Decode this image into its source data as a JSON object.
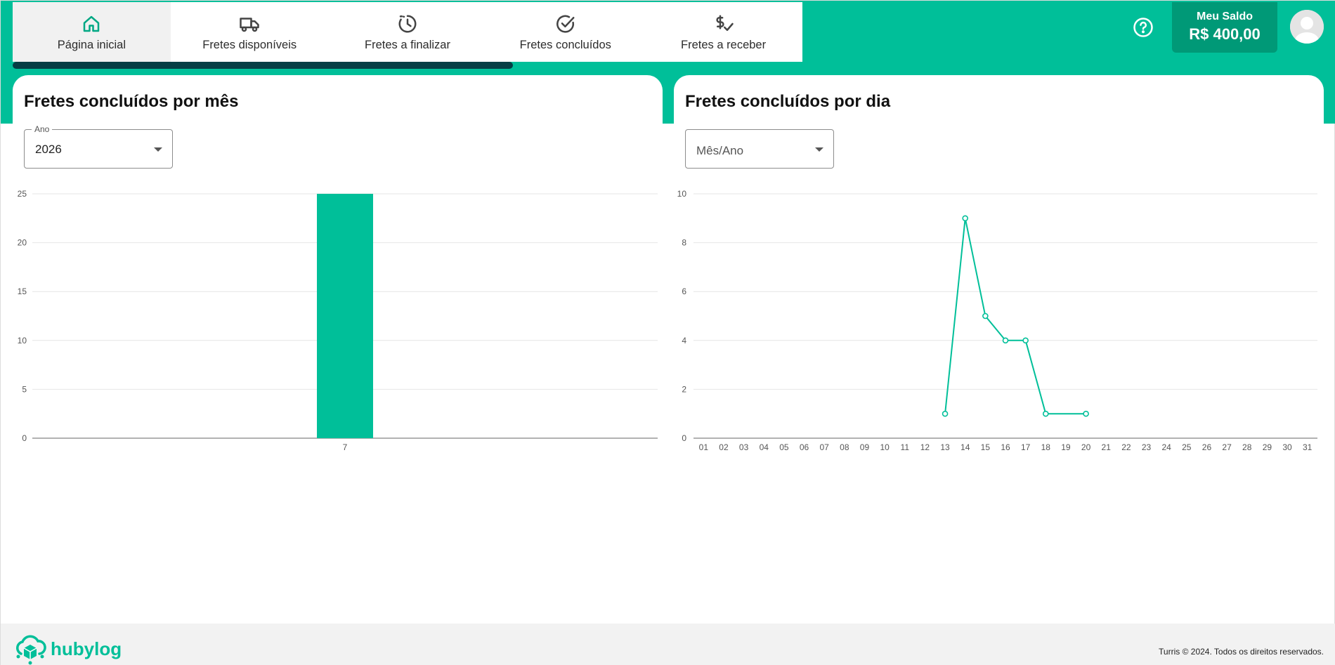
{
  "nav": {
    "items": [
      {
        "label": "Página inicial",
        "icon": "home-icon",
        "active": true
      },
      {
        "label": "Fretes disponíveis",
        "icon": "truck-icon",
        "active": false
      },
      {
        "label": "Fretes a finalizar",
        "icon": "clock-history-icon",
        "active": false
      },
      {
        "label": "Fretes concluídos",
        "icon": "check-circle-icon",
        "active": false
      },
      {
        "label": "Fretes a receber",
        "icon": "dollar-check-icon",
        "active": false
      }
    ],
    "progress_fraction": 0.76
  },
  "header": {
    "balance_label": "Meu Saldo",
    "balance_value": "R$ 400,00"
  },
  "colors": {
    "brand": "#00bf99",
    "brand_dark": "#009977",
    "progress_dark": "#063e45"
  },
  "monthly": {
    "title": "Fretes concluídos por mês",
    "select_label": "Ano",
    "select_value": "2026"
  },
  "daily": {
    "title": "Fretes concluídos por dia",
    "select_placeholder": "Mês/Ano"
  },
  "footer": {
    "logo_text": "hubylog",
    "copyright": "Turris © 2024. Todos os direitos reservados."
  },
  "chart_data": [
    {
      "type": "bar",
      "categories": [
        "7"
      ],
      "values": [
        25
      ],
      "ylim": [
        0,
        25
      ],
      "yticks": [
        "0",
        "5",
        "10",
        "15",
        "20",
        "25"
      ],
      "grid": true,
      "color": "#00bf99"
    },
    {
      "type": "line",
      "categories": [
        "01",
        "02",
        "03",
        "04",
        "05",
        "06",
        "07",
        "08",
        "09",
        "10",
        "11",
        "12",
        "13",
        "14",
        "15",
        "16",
        "17",
        "18",
        "19",
        "20",
        "21",
        "22",
        "23",
        "24",
        "25",
        "26",
        "27",
        "28",
        "29",
        "30",
        "31"
      ],
      "x": [
        "13",
        "14",
        "15",
        "16",
        "17",
        "18",
        "20"
      ],
      "values": [
        1,
        9,
        5,
        4,
        4,
        1,
        1
      ],
      "ylim": [
        0,
        10
      ],
      "yticks": [
        "0",
        "2",
        "4",
        "6",
        "8",
        "10"
      ],
      "grid": true,
      "color": "#00bf99"
    }
  ]
}
